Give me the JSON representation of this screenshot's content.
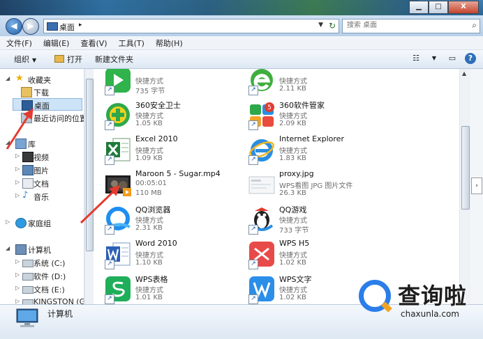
{
  "window": {
    "minimize_glyph": "▁",
    "maximize_glyph": "□",
    "close_glyph": "X"
  },
  "address": {
    "location": "桌面",
    "separator": "▸",
    "dropdown_glyph": "▼",
    "refresh_glyph": "↻"
  },
  "search": {
    "placeholder": "搜索 桌面",
    "icon": "search-icon"
  },
  "menu": [
    "文件(F)",
    "编辑(E)",
    "查看(V)",
    "工具(T)",
    "帮助(H)"
  ],
  "toolbar": {
    "organize": "组织",
    "open": "打开",
    "new_folder": "新建文件夹"
  },
  "nav": {
    "favorites": "收藏夹",
    "downloads": "下载",
    "desktop": "桌面",
    "recent": "最近访问的位置",
    "libraries": "库",
    "videos": "视频",
    "pictures": "图片",
    "documents": "文档",
    "music": "音乐",
    "homegroup": "家庭组",
    "computer": "计算机",
    "drive_c": "系统 (C:)",
    "drive_d": "软件 (D:)",
    "drive_e": "文档 (E:)",
    "drive_g": "KINGSTON (G:)"
  },
  "files": {
    "f1": {
      "name": "",
      "type": "快捷方式",
      "size": "735 字节",
      "icon": "app-icon",
      "color": "#2fb34a"
    },
    "f2": {
      "name": "",
      "type": "快捷方式",
      "size": "2.11 KB",
      "icon": "ie-green-icon",
      "color": "#3fae3f"
    },
    "f3": {
      "name": "360安全卫士",
      "type": "快捷方式",
      "size": "1.05 KB",
      "icon": "360-safe-icon",
      "color": "#2ea84a"
    },
    "f4": {
      "name": "360软件管家",
      "type": "快捷方式",
      "size": "2.09 KB",
      "icon": "360-manager-icon",
      "color": "#e94b3c"
    },
    "f5": {
      "name": "Excel 2010",
      "type": "快捷方式",
      "size": "1.09 KB",
      "icon": "excel-icon",
      "color": "#1f7a3a"
    },
    "f6": {
      "name": "Internet Explorer",
      "type": "快捷方式",
      "size": "1.83 KB",
      "icon": "ie-icon",
      "color": "#2a8ee0"
    },
    "f7": {
      "name": "Maroon 5 - Sugar.mp4",
      "type": "00:05:01",
      "size": "110 MB",
      "icon": "video-thumbnail-icon",
      "color": "#333333"
    },
    "f8": {
      "name": "proxy.jpg",
      "type": "WPS看图 JPG 图片文件",
      "size": "26.3 KB",
      "icon": "image-thumbnail-icon",
      "color": "#c0c8d0"
    },
    "f9": {
      "name": "QQ浏览器",
      "type": "快捷方式",
      "size": "2.31 KB",
      "icon": "qq-browser-icon",
      "color": "#1e8ff0"
    },
    "f10": {
      "name": "QQ游戏",
      "type": "快捷方式",
      "size": "733 字节",
      "icon": "qq-game-icon",
      "color": "#222222"
    },
    "f11": {
      "name": "Word 2010",
      "type": "快捷方式",
      "size": "1.10 KB",
      "icon": "word-icon",
      "color": "#2b5fb5"
    },
    "f12": {
      "name": "WPS H5",
      "type": "快捷方式",
      "size": "1.02 KB",
      "icon": "wps-h5-icon",
      "color": "#e84a4a"
    },
    "f13": {
      "name": "WPS表格",
      "type": "快捷方式",
      "size": "1.01 KB",
      "icon": "wps-sheet-icon",
      "color": "#1fae5a"
    },
    "f14": {
      "name": "WPS文字",
      "type": "快捷方式",
      "size": "1.02 KB",
      "icon": "wps-writer-icon",
      "color": "#2b8ee8"
    }
  },
  "shortcut_glyph": "↗",
  "details": {
    "label": "计算机"
  },
  "watermark": {
    "text": "查询啦",
    "url": "chaxunla.com"
  },
  "accent": "#2b7de9",
  "annotation_color": "#e53a2f"
}
